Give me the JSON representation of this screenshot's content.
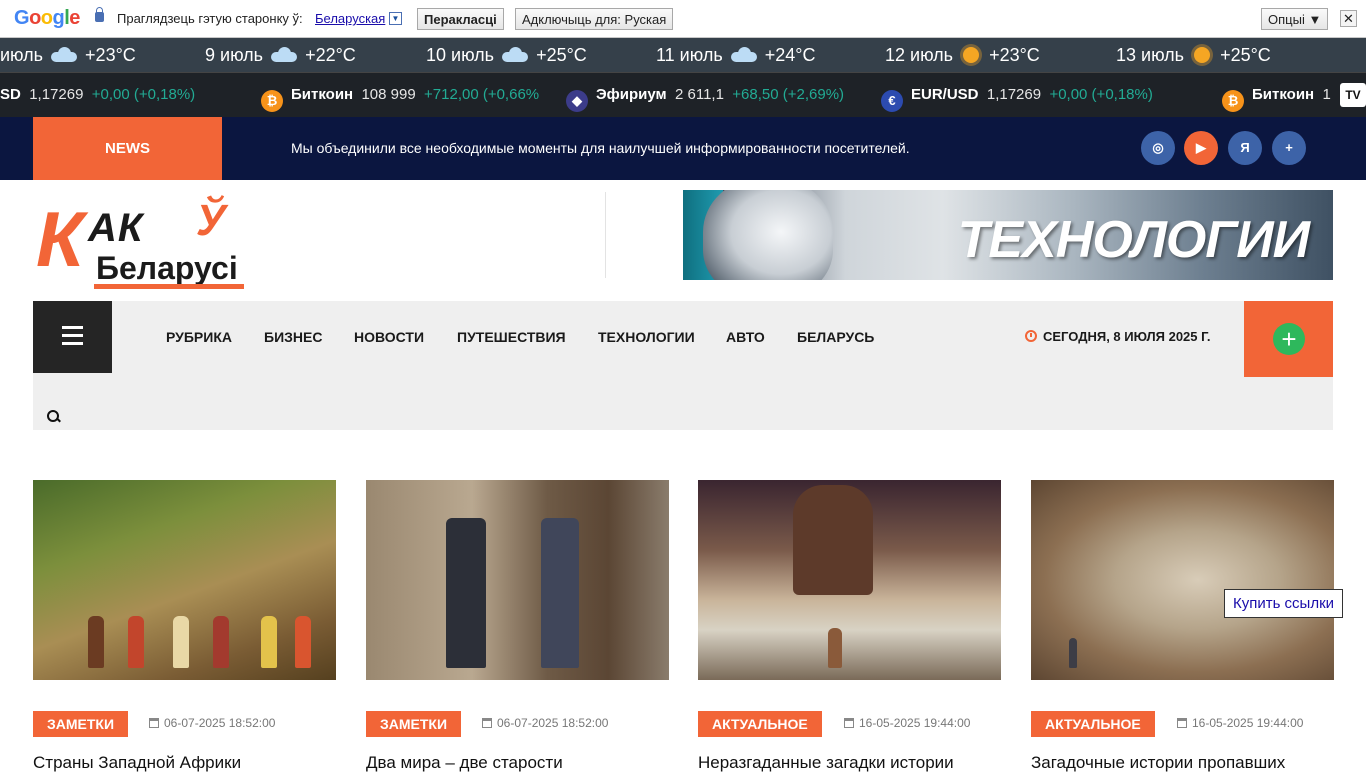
{
  "translate_bar": {
    "logo_letters": [
      "G",
      "o",
      "o",
      "g",
      "l",
      "e"
    ],
    "prompt": "Праглядзець гэтую старонку ў:",
    "language": "Беларуская",
    "dropdown_glyph": "▼",
    "translate_button": "Перакласці",
    "disable_button": "Адключыць для: Руская",
    "options_button": "Опцыі ▼",
    "close_glyph": "✕"
  },
  "weather": [
    {
      "date": "июль",
      "icon": "cloud-icon",
      "temp": "+23°C"
    },
    {
      "date": "9 июль",
      "icon": "cloud-icon",
      "temp": "+22°C"
    },
    {
      "date": "10 июль",
      "icon": "cloud-icon",
      "temp": "+25°C"
    },
    {
      "date": "11 июль",
      "icon": "cloud-icon",
      "temp": "+24°C"
    },
    {
      "date": "12 июль",
      "icon": "sun-icon",
      "temp": "+23°C"
    },
    {
      "date": "13 июль",
      "icon": "sun-icon",
      "temp": "+25°C"
    }
  ],
  "ticker": [
    {
      "name": "SD",
      "price": "1,17269",
      "change": "+0,00 (+0,18%)"
    },
    {
      "name": "Биткоин",
      "price": "108 999",
      "change": "+712,00 (+0,66%",
      "coin": "₿"
    },
    {
      "name": "Эфириум",
      "price": "2 611,1",
      "change": "+68,50 (+2,69%)",
      "coin": "◆"
    },
    {
      "name": "EUR/USD",
      "price": "1,17269",
      "change": "+0,00 (+0,18%)",
      "coin": "€"
    },
    {
      "name": "Биткоин",
      "price": "1",
      "coin": "₿"
    }
  ],
  "ticker_logo": "TV",
  "newsbar": {
    "label": "NEWS",
    "message": "Мы объединили все необходимые моменты для наилучшей информированности посетителей.",
    "social": [
      "◎",
      "▶",
      "Я",
      "+"
    ]
  },
  "logo": {
    "k": "К",
    "ak": "АК",
    "u": "Ў",
    "bel": "Беларусі"
  },
  "banner": {
    "text": "ТЕХНОЛОГИИ"
  },
  "nav": {
    "items": [
      "РУБРИКА",
      "БИЗНЕС",
      "НОВОСТИ",
      "ПУТЕШЕСТВИЯ",
      "ТЕХНОЛОГИИ",
      "АВТО",
      "БЕЛАРУСЬ"
    ],
    "date": "СЕГОДНЯ, 8 ИЮЛЯ 2025 Г.",
    "plus": "+"
  },
  "cards": [
    {
      "category": "ЗАМЕТКИ",
      "date": "06-07-2025 18:52:00",
      "title": "Страны Западной Африки"
    },
    {
      "category": "ЗАМЕТКИ",
      "date": "06-07-2025 18:52:00",
      "title": "Два мира – две старости"
    },
    {
      "category": "АКТУАЛЬНОЕ",
      "date": "16-05-2025 19:44:00",
      "title": "Неразгаданные загадки истории"
    },
    {
      "category": "АКТУАЛЬНОЕ",
      "date": "16-05-2025 19:44:00",
      "title": "Загадочные истории пропавших"
    }
  ],
  "buy_link": "Купить ссылки",
  "colors": {
    "accent": "#f26537",
    "navy": "#0b1640",
    "ticker_positive": "#22ab94"
  }
}
